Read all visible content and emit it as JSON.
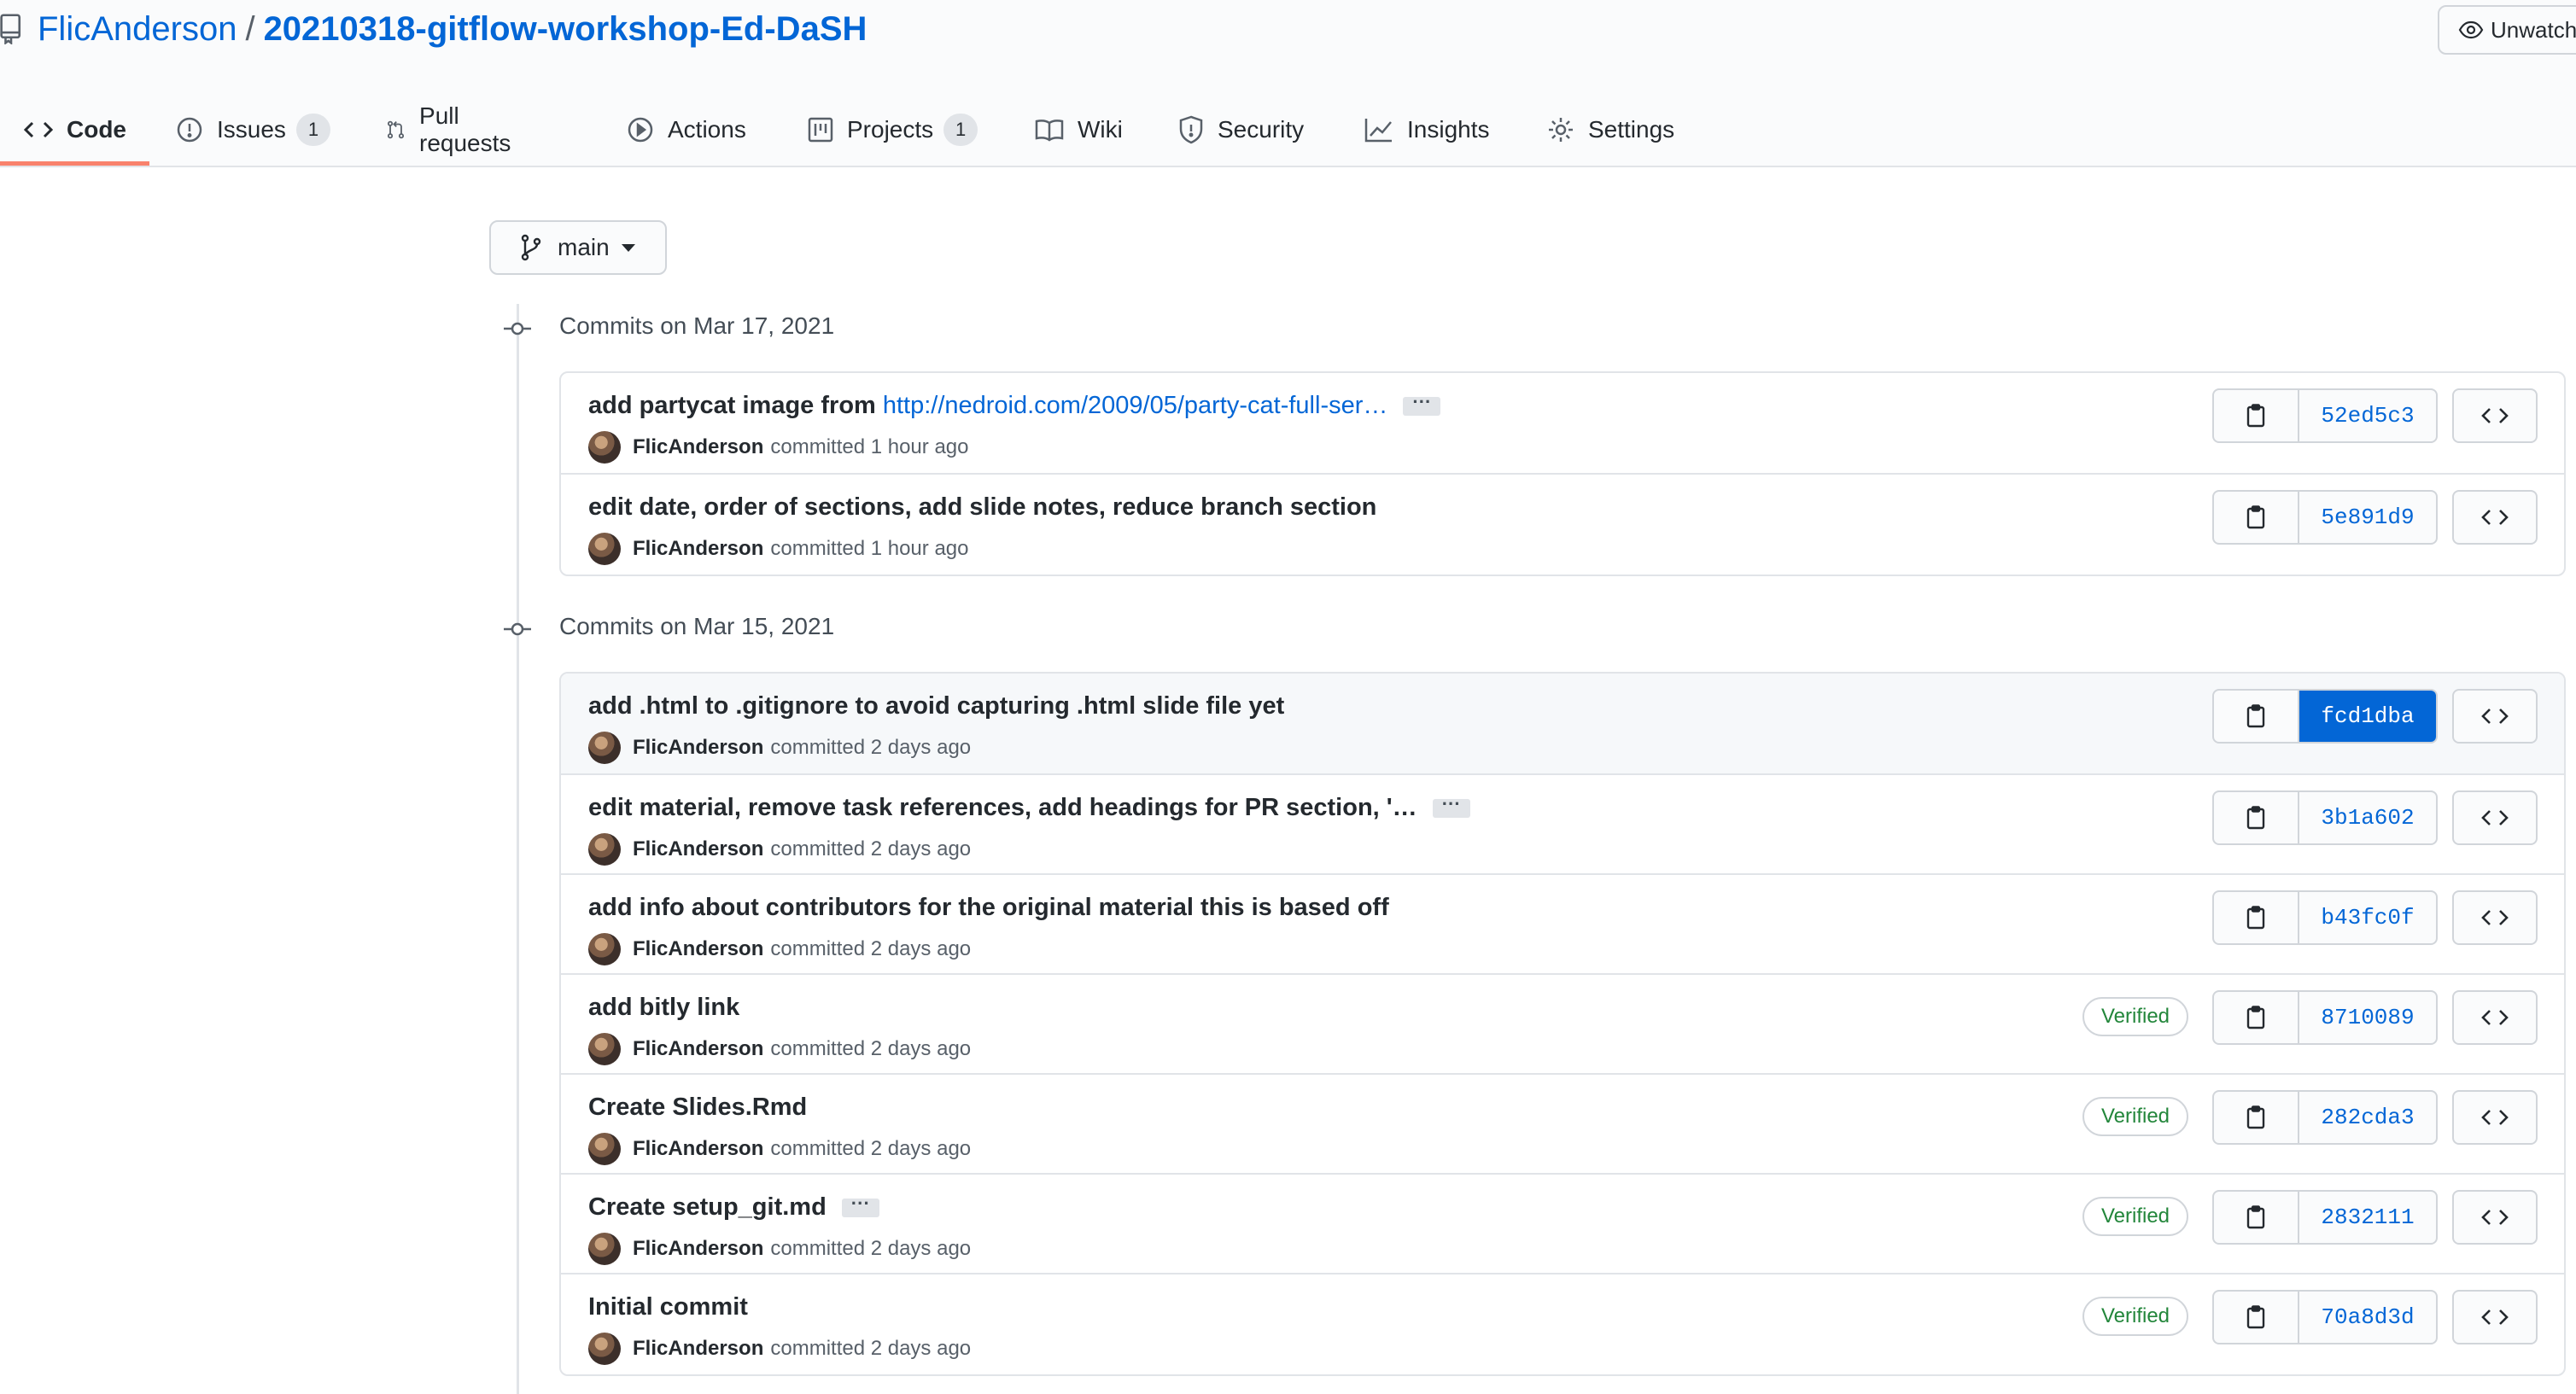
{
  "repo": {
    "owner": "FlicAnderson",
    "separator": "/",
    "name": "20210318-gitflow-workshop-Ed-DaSH"
  },
  "watch": {
    "label": "Unwatch"
  },
  "tabs": [
    {
      "label": "Code",
      "icon": "code-icon"
    },
    {
      "label": "Issues",
      "icon": "issue-icon",
      "count": "1"
    },
    {
      "label": "Pull requests",
      "icon": "pull-request-icon"
    },
    {
      "label": "Actions",
      "icon": "play-icon"
    },
    {
      "label": "Projects",
      "icon": "project-icon",
      "count": "1"
    },
    {
      "label": "Wiki",
      "icon": "book-icon"
    },
    {
      "label": "Security",
      "icon": "shield-icon"
    },
    {
      "label": "Insights",
      "icon": "graph-icon"
    },
    {
      "label": "Settings",
      "icon": "gear-icon"
    }
  ],
  "branch": {
    "label": "main"
  },
  "groups": [
    {
      "title": "Commits on Mar 17, 2021",
      "commits": [
        {
          "message": "add partycat image from",
          "link": "http://nedroid.com/2009/05/party-cat-full-ser…",
          "ellipsis": "···",
          "author": "FlicAnderson",
          "time": "committed 1 hour ago",
          "sha": "52ed5c3"
        },
        {
          "message": "edit date, order of sections, add slide notes, reduce branch section",
          "author": "FlicAnderson",
          "time": "committed 1 hour ago",
          "sha": "5e891d9"
        }
      ]
    },
    {
      "title": "Commits on Mar 15, 2021",
      "commits": [
        {
          "message": "add .html to .gitignore to avoid capturing .html slide file yet",
          "author": "FlicAnderson",
          "time": "committed 2 days ago",
          "sha": "fcd1dba"
        },
        {
          "message": "edit material, remove task references, add headings for PR section, '…",
          "ellipsis": "···",
          "author": "FlicAnderson",
          "time": "committed 2 days ago",
          "sha": "3b1a602"
        },
        {
          "message": "add info about contributors for the original material this is based off",
          "author": "FlicAnderson",
          "time": "committed 2 days ago",
          "sha": "b43fc0f"
        },
        {
          "message": "add bitly link",
          "author": "FlicAnderson",
          "time": "committed 2 days ago",
          "sha": "8710089",
          "verified": "Verified"
        },
        {
          "message": "Create Slides.Rmd",
          "author": "FlicAnderson",
          "time": "committed 2 days ago",
          "sha": "282cda3",
          "verified": "Verified"
        },
        {
          "message": "Create setup_git.md",
          "ellipsis": "···",
          "author": "FlicAnderson",
          "time": "committed 2 days ago",
          "sha": "2832111",
          "verified": "Verified"
        },
        {
          "message": "Initial commit",
          "author": "FlicAnderson",
          "time": "committed 2 days ago",
          "sha": "70a8d3d",
          "verified": "Verified"
        }
      ]
    }
  ],
  "colors": {
    "link": "#0366d6",
    "active_tab_underline": "#f9826c",
    "verified": "#22863a",
    "selected_sha_bg": "#0366d6"
  }
}
